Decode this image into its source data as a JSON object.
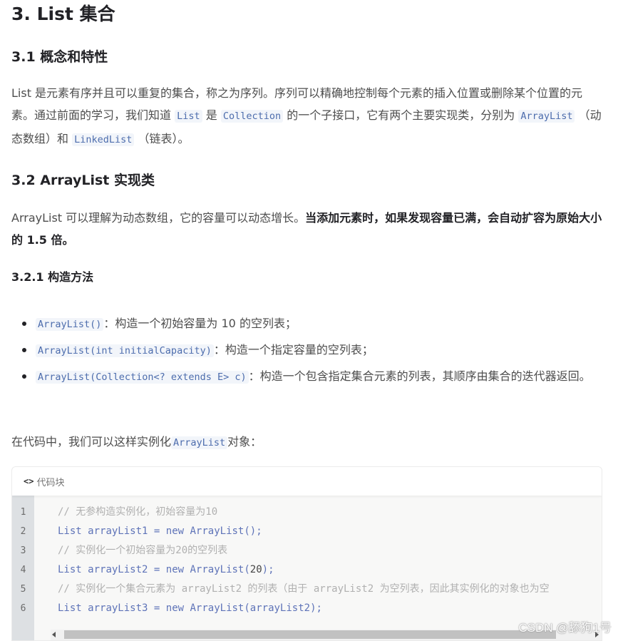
{
  "h1": "3. List 集合",
  "s31": {
    "title": "3.1 概念和特性"
  },
  "p1": {
    "a": "List 是元素有序并且可以重复的集合，称之为序列。序列可以精确地控制每个元素的插入位置或删除某个位置的元素。通过前面的学习，我们知道",
    "c1": "List",
    "b": "是",
    "c2": "Collection",
    "c": "的一个子接口，它有两个主要实现类，分别为",
    "c3": "ArrayList",
    "d": "（动态数组）和",
    "c4": "LinkedList",
    "e": "（链表）。"
  },
  "s32": {
    "title": "3.2 ArrayList 实现类"
  },
  "p2": {
    "a": "ArrayList 可以理解为动态数组，它的容量可以动态增长。",
    "bold": "当添加元素时，如果发现容量已满，会自动扩容为原始大小的 1.5 倍。"
  },
  "s321": {
    "title": "3.2.1 构造方法"
  },
  "ctors": [
    {
      "code": "ArrayList()",
      "text": "：构造一个初始容量为 10 的空列表；"
    },
    {
      "code": "ArrayList(int initialCapacity)",
      "text": "：构造一个指定容量的空列表；"
    },
    {
      "code": "ArrayList(Collection<? extends E> c)",
      "text": "：构造一个包含指定集合元素的列表，其顺序由集合的迭代器返回。"
    }
  ],
  "p3": {
    "a": "在代码中，我们可以这样实例化",
    "code": "ArrayList",
    "b": "对象："
  },
  "codeblock": {
    "label": "代码块",
    "icon": "code-brackets-icon",
    "lines": [
      {
        "n": "1",
        "comment": "// 无参构造实例化，初始容量为10"
      },
      {
        "n": "2",
        "type": "List",
        "var": "arrayList1",
        "eq": "=",
        "kw": "new",
        "cls": "ArrayList",
        "args": "();"
      },
      {
        "n": "3",
        "comment": "// 实例化一个初始容量为20的空列表"
      },
      {
        "n": "4",
        "type": "List",
        "var": "arrayList2",
        "eq": "=",
        "kw": "new",
        "cls": "ArrayList",
        "args_open": "(",
        "num": "20",
        "args_close": ");"
      },
      {
        "n": "5",
        "comment": "// 实例化一个集合元素为 arrayList2 的列表（由于 arrayList2 为空列表，因此其实例化的对象也为空"
      },
      {
        "n": "6",
        "type": "List",
        "var": "arrayList3",
        "eq": "=",
        "kw": "new",
        "cls": "ArrayList",
        "args": "(arrayList2);"
      }
    ]
  },
  "watermark": "CSDN @舔狗1号"
}
